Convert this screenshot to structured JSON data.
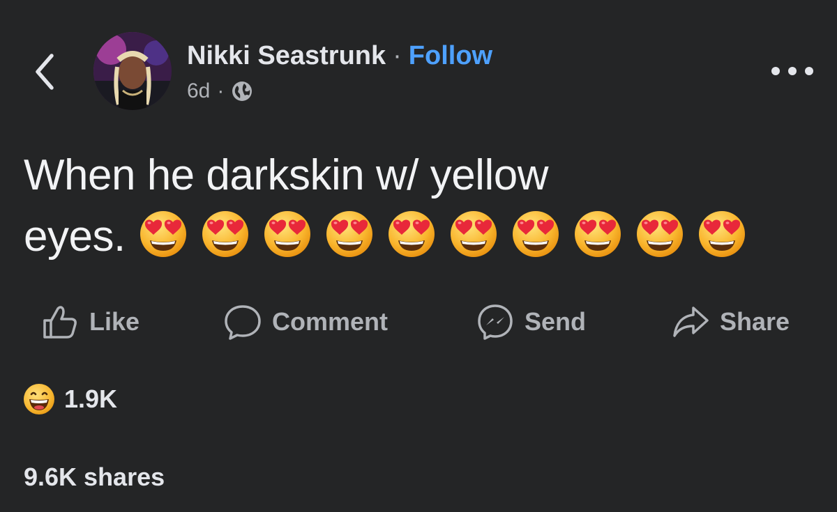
{
  "post": {
    "author": {
      "name": "Nikki Seastrunk",
      "separator": "·",
      "follow_label": "Follow"
    },
    "meta": {
      "time": "6d",
      "separator": "·",
      "audience_icon": "globe-icon"
    },
    "text": {
      "line1": "When he darkskin w/ yellow",
      "line2": "eyes.",
      "emoji": "heart-eyes-emoji",
      "emoji_count": 10
    }
  },
  "actions": {
    "like_label": "Like",
    "comment_label": "Comment",
    "send_label": "Send",
    "share_label": "Share"
  },
  "stats": {
    "reaction_icon": "haha-reaction-icon",
    "reaction_count": "1.9K",
    "shares_count": "9.6K",
    "shares_label": "shares"
  },
  "colors": {
    "background": "#242526",
    "primary_text": "#e4e6eb",
    "secondary_text": "#b0b3b8",
    "follow_blue": "#4ea1ff"
  }
}
